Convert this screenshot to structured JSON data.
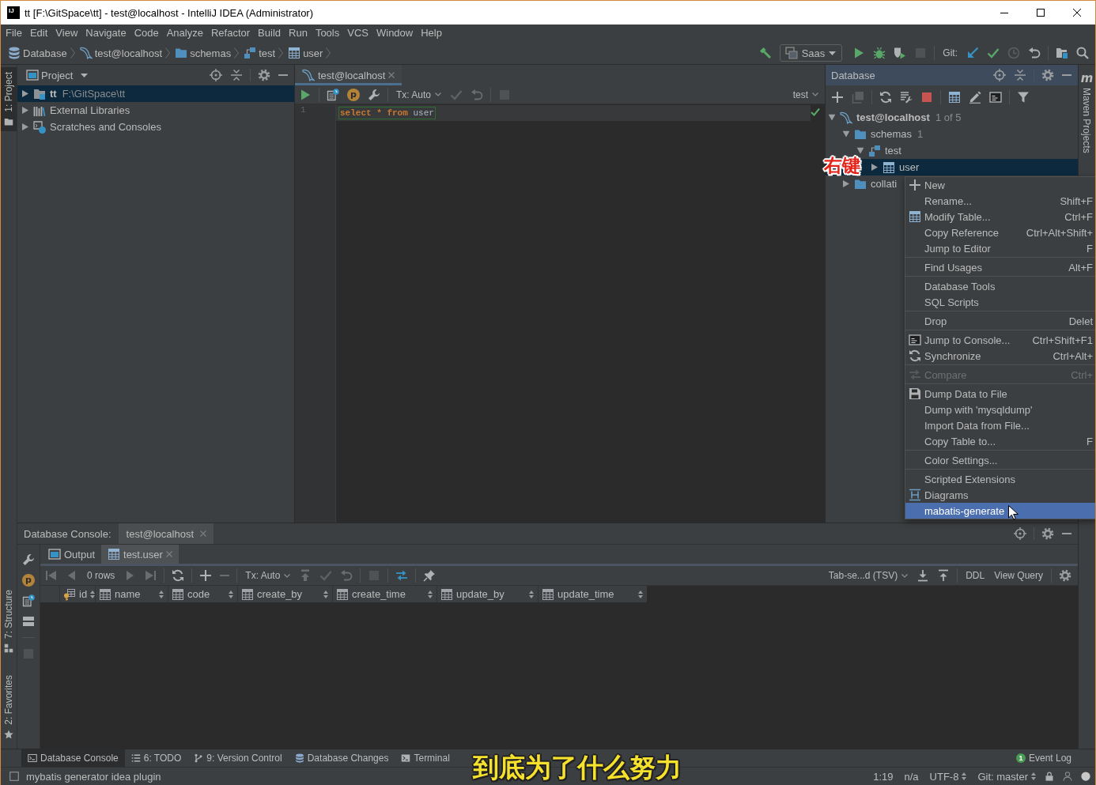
{
  "window": {
    "logo": "IJ",
    "title": "tt [F:\\GitSpace\\tt] - test@localhost - IntelliJ IDEA (Administrator)"
  },
  "menu": [
    "File",
    "Edit",
    "View",
    "Navigate",
    "Code",
    "Analyze",
    "Refactor",
    "Build",
    "Run",
    "Tools",
    "VCS",
    "Window",
    "Help"
  ],
  "breadcrumbs": [
    {
      "label": "Database",
      "kind": "database"
    },
    {
      "label": "test@localhost",
      "kind": "connection"
    },
    {
      "label": "schemas",
      "kind": "folder"
    },
    {
      "label": "test",
      "kind": "schema"
    },
    {
      "label": "user",
      "kind": "table"
    }
  ],
  "main_toolbar": [
    [
      {
        "kind": "build",
        "disabled": false
      },
      {
        "kind": "config",
        "text": "Saas",
        "disabled": false
      },
      {
        "kind": "run",
        "disabled": false
      },
      {
        "kind": "debug",
        "disabled": false
      },
      {
        "kind": "coverage",
        "disabled": false
      },
      {
        "kind": "stop",
        "disabled": true
      }
    ],
    [
      {
        "kind": "label",
        "text": "Git:",
        "disabled": false
      },
      {
        "kind": "vcs-update",
        "disabled": false
      },
      {
        "kind": "commit",
        "disabled": false
      },
      {
        "kind": "history",
        "disabled": true
      },
      {
        "kind": "revert",
        "disabled": false
      }
    ],
    [
      {
        "kind": "project-structure",
        "disabled": false
      },
      {
        "kind": "search",
        "disabled": false
      }
    ]
  ],
  "left_tool_tabs": {
    "top": [
      {
        "label": "1: Project",
        "kind": "project",
        "selected": true
      }
    ],
    "bottom": [
      {
        "label": "7: Structure",
        "kind": "structure",
        "selected": false
      },
      {
        "label": "2: Favorites",
        "kind": "favorites",
        "selected": false
      }
    ]
  },
  "project_panel": {
    "title": "Project",
    "tree": [
      {
        "label": "tt",
        "path": "F:\\GitSpace\\tt",
        "kind": "module",
        "expanded": false,
        "selected": true
      },
      {
        "label": "External Libraries",
        "kind": "libraries",
        "expanded": false,
        "selected": false
      },
      {
        "label": "Scratches and Consoles",
        "kind": "scratches",
        "expanded": false,
        "selected": false
      }
    ]
  },
  "editor": {
    "tabs": [
      {
        "label": "test@localhost",
        "selected": true,
        "closable": true
      }
    ],
    "toolbar": [
      [
        {
          "kind": "run",
          "disabled": false
        }
      ],
      [
        {
          "kind": "console",
          "disabled": false
        },
        {
          "kind": "parameters",
          "glyph": "p",
          "disabled": false
        },
        {
          "kind": "wrench",
          "disabled": false
        }
      ],
      [
        {
          "kind": "dropdown",
          "text": "Tx: Auto",
          "disabled": false
        },
        {
          "kind": "commit",
          "disabled": true
        },
        {
          "kind": "rollback",
          "disabled": true
        }
      ],
      [
        {
          "kind": "stop",
          "disabled": true
        }
      ]
    ],
    "toolbar_right": [
      [
        {
          "kind": "dropdown",
          "text": "test",
          "disabled": false
        }
      ]
    ],
    "lines": [
      {
        "number": "1",
        "current": true,
        "tokens": [
          {
            "text": "select",
            "kind": "keyword"
          },
          {
            "text": "*",
            "kind": "keyword"
          },
          {
            "text": "from",
            "kind": "keyword"
          },
          {
            "text": "user",
            "kind": "identifier"
          }
        ]
      }
    ]
  },
  "database_panel": {
    "title": "Database",
    "toolbar": [
      [
        {
          "kind": "add",
          "disabled": false
        },
        {
          "kind": "duplicate",
          "disabled": true
        }
      ],
      [
        {
          "kind": "refresh",
          "disabled": false
        },
        {
          "kind": "db-tools",
          "disabled": false
        },
        {
          "kind": "stop",
          "disabled": false
        }
      ],
      [
        {
          "kind": "table",
          "disabled": false
        },
        {
          "kind": "edit",
          "disabled": false
        },
        {
          "kind": "sql-console",
          "disabled": false
        }
      ],
      [
        {
          "kind": "filter",
          "disabled": false
        }
      ]
    ],
    "tree": [
      {
        "label": "test@localhost",
        "count": "1 of 5",
        "kind": "connection",
        "expanded": true,
        "selected": false,
        "children": [
          {
            "label": "schemas",
            "count": "1",
            "kind": "folder",
            "expanded": true,
            "selected": false,
            "children": [
              {
                "label": "test",
                "kind": "schema",
                "expanded": true,
                "selected": false,
                "children": [
                  {
                    "label": "user",
                    "kind": "table",
                    "expanded": false,
                    "selected": true
                  }
                ]
              }
            ]
          },
          {
            "label": "collati",
            "kind": "folder",
            "expanded": false,
            "selected": false
          }
        ]
      }
    ]
  },
  "annotation": "右键",
  "context_menu": {
    "sections": [
      [
        {
          "label": "New",
          "kind": "add",
          "selected": false,
          "disabled": false
        },
        {
          "label": "Rename...",
          "shortcut": "Shift+F",
          "kind": "plain",
          "selected": false,
          "disabled": false
        },
        {
          "label": "Modify Table...",
          "shortcut": "Ctrl+F",
          "kind": "table",
          "selected": false,
          "disabled": false
        },
        {
          "label": "Copy Reference",
          "shortcut": "Ctrl+Alt+Shift+",
          "kind": "plain",
          "selected": false,
          "disabled": false
        },
        {
          "label": "Jump to Editor",
          "shortcut": "F",
          "kind": "plain",
          "selected": false,
          "disabled": false
        }
      ],
      [
        {
          "label": "Find Usages",
          "shortcut": "Alt+F",
          "kind": "plain",
          "selected": false,
          "disabled": false
        }
      ],
      [
        {
          "label": "Database Tools",
          "kind": "plain",
          "selected": false,
          "disabled": false
        },
        {
          "label": "SQL Scripts",
          "kind": "plain",
          "selected": false,
          "disabled": false
        }
      ],
      [
        {
          "label": "Drop",
          "shortcut": "Delet",
          "kind": "plain",
          "selected": false,
          "disabled": false
        }
      ],
      [
        {
          "label": "Jump to Console...",
          "shortcut": "Ctrl+Shift+F1",
          "kind": "sql-console",
          "selected": false,
          "disabled": false
        },
        {
          "label": "Synchronize",
          "shortcut": "Ctrl+Alt+",
          "kind": "refresh",
          "selected": false,
          "disabled": false
        }
      ],
      [
        {
          "label": "Compare",
          "shortcut": "Ctrl+",
          "kind": "compare",
          "selected": false,
          "disabled": true
        }
      ],
      [
        {
          "label": "Dump Data to File",
          "kind": "save",
          "selected": false,
          "disabled": false
        },
        {
          "label": "Dump with 'mysqldump'",
          "kind": "plain",
          "selected": false,
          "disabled": false
        },
        {
          "label": "Import Data from File...",
          "kind": "plain",
          "selected": false,
          "disabled": false
        },
        {
          "label": "Copy Table to...",
          "shortcut": "F",
          "kind": "plain",
          "selected": false,
          "disabled": false
        }
      ],
      [
        {
          "label": "Color Settings...",
          "kind": "plain",
          "selected": false,
          "disabled": false
        }
      ],
      [
        {
          "label": "Scripted Extensions",
          "kind": "plain",
          "selected": false,
          "disabled": false
        },
        {
          "label": "Diagrams",
          "kind": "diagram",
          "selected": false,
          "disabled": false
        },
        {
          "label": "mabatis-generate",
          "kind": "plain",
          "selected": true,
          "disabled": false
        }
      ]
    ]
  },
  "right_tool_tabs": [
    {
      "label": "Maven Projects",
      "glyph": "m",
      "selected": false
    }
  ],
  "bottom_panel": {
    "title": "Database Console:",
    "tabs": [
      {
        "label": "test@localhost",
        "selected": true,
        "closable": true
      }
    ],
    "side_toolbar": [
      [
        {
          "kind": "wrench",
          "disabled": false
        },
        {
          "kind": "parameters",
          "glyph": "p",
          "disabled": false
        },
        {
          "kind": "console",
          "disabled": false
        },
        {
          "kind": "layout",
          "disabled": false
        }
      ],
      [
        {
          "kind": "stop",
          "disabled": true
        }
      ]
    ],
    "subtabs": [
      {
        "label": "Output",
        "kind": "output",
        "selected": false,
        "closable": false
      },
      {
        "label": "test.user",
        "kind": "table",
        "selected": true,
        "closable": true
      }
    ],
    "results_toolbar": [
      [
        {
          "kind": "first",
          "disabled": true
        },
        {
          "kind": "prev",
          "disabled": true
        },
        {
          "kind": "label",
          "text": "0 rows",
          "disabled": false
        },
        {
          "kind": "next",
          "disabled": true
        },
        {
          "kind": "last",
          "disabled": true
        }
      ],
      [
        {
          "kind": "refresh",
          "disabled": false
        }
      ],
      [
        {
          "kind": "add",
          "disabled": false
        },
        {
          "kind": "remove",
          "disabled": true
        }
      ],
      [
        {
          "kind": "dropdown",
          "text": "Tx: Auto",
          "disabled": false
        },
        {
          "kind": "submit",
          "disabled": true
        },
        {
          "kind": "commit",
          "disabled": true
        },
        {
          "kind": "rollback",
          "disabled": true
        }
      ],
      [
        {
          "kind": "stop",
          "disabled": true
        }
      ],
      [
        {
          "kind": "compare",
          "disabled": false
        }
      ],
      [
        {
          "kind": "pin",
          "disabled": false
        }
      ]
    ],
    "results_toolbar_right": [
      [
        {
          "kind": "dropdown",
          "text": "Tab-se...d (TSV)",
          "disabled": false
        },
        {
          "kind": "export",
          "disabled": false
        },
        {
          "kind": "import",
          "disabled": false
        }
      ],
      [
        {
          "kind": "link",
          "text": "DDL",
          "disabled": false
        },
        {
          "kind": "link",
          "text": "View Query",
          "disabled": false
        }
      ],
      [
        {
          "kind": "settings",
          "disabled": false
        }
      ]
    ],
    "columns": [
      {
        "name": "id",
        "kind": "key"
      },
      {
        "name": "name",
        "kind": "column"
      },
      {
        "name": "code",
        "kind": "column"
      },
      {
        "name": "create_by",
        "kind": "column"
      },
      {
        "name": "create_time",
        "kind": "column"
      },
      {
        "name": "update_by",
        "kind": "column"
      },
      {
        "name": "update_time",
        "kind": "column"
      }
    ]
  },
  "tool_windows": [
    {
      "label": "Database Console",
      "kind": "database-console",
      "selected": true
    },
    {
      "label": "6: TODO",
      "kind": "todo",
      "selected": false
    },
    {
      "label": "9: Version Control",
      "kind": "vcs",
      "selected": false
    },
    {
      "label": "Database Changes",
      "kind": "database",
      "selected": false
    },
    {
      "label": "Terminal",
      "kind": "terminal",
      "selected": false
    }
  ],
  "event_log": {
    "label": "Event Log",
    "count": "1"
  },
  "status_bar": {
    "message": "mybatis generator idea plugin",
    "items": [
      {
        "text": "1:19",
        "kind": "plain"
      },
      {
        "text": "n/a",
        "kind": "plain"
      },
      {
        "text": "UTF-8",
        "kind": "switch"
      },
      {
        "text": "Git: master",
        "kind": "switch"
      }
    ]
  },
  "caption": "到底为了什么努力"
}
